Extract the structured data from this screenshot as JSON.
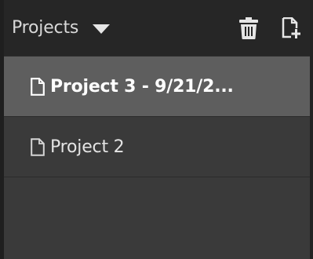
{
  "header": {
    "title": "Projects",
    "dropdown_icon": "caret-down-icon",
    "delete_icon": "trash-icon",
    "new_icon": "new-file-icon"
  },
  "projects": [
    {
      "label": "Project 3 - 9/21/2...",
      "selected": true
    },
    {
      "label": "Project 2",
      "selected": false
    }
  ],
  "colors": {
    "header_bg": "#262626",
    "panel_bg": "#3a3a3a",
    "selected_bg": "#5e5e5e",
    "text": "#e4e4e4"
  }
}
